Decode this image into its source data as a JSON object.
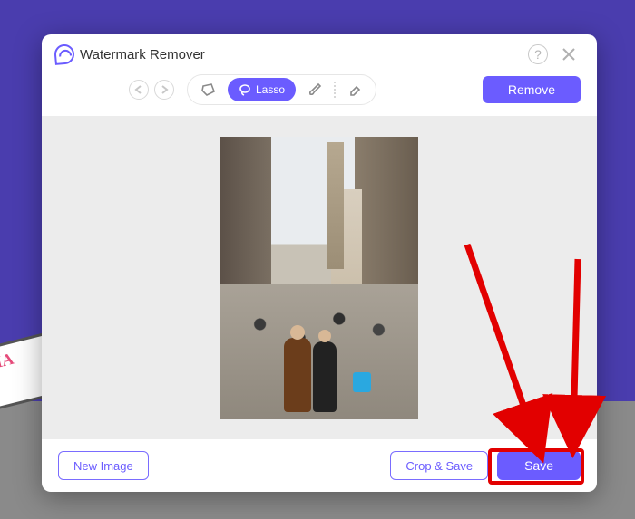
{
  "header": {
    "title": "Watermark Remover"
  },
  "toolbar": {
    "lasso_label": "Lasso",
    "remove_label": "Remove"
  },
  "footer": {
    "new_image_label": "New Image",
    "crop_save_label": "Crop & Save",
    "save_label": "Save"
  },
  "colors": {
    "accent": "#6b5cff",
    "highlight": "#e20000"
  }
}
